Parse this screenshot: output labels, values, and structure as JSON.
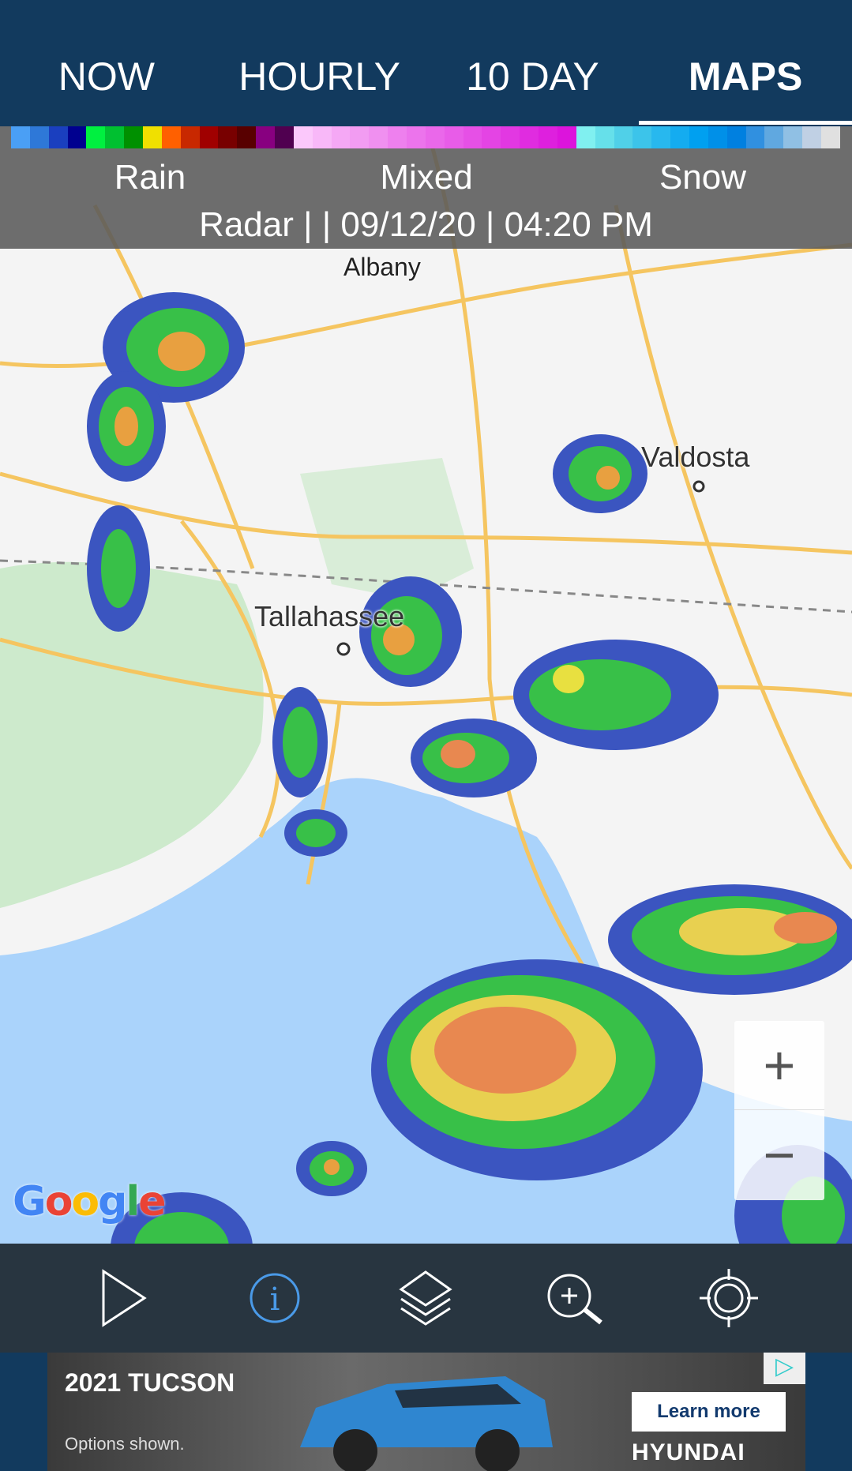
{
  "tabs": [
    {
      "label": "NOW"
    },
    {
      "label": "HOURLY"
    },
    {
      "label": "10 DAY"
    },
    {
      "label": "MAPS",
      "active": true
    }
  ],
  "legend": {
    "labels": {
      "rain": "Rain",
      "mixed": "Mixed",
      "snow": "Snow"
    },
    "rain_colors": [
      "#4a9ff5",
      "#2e78d8",
      "#1a3fbf",
      "#00008f",
      "#00f040",
      "#00c030",
      "#009000",
      "#f0e000",
      "#ff6000",
      "#c82800",
      "#a00000",
      "#780000",
      "#580000",
      "#880080",
      "#500050"
    ],
    "mixed_colors": [
      "#fbc8fb",
      "#f8b8f8",
      "#f5a8f5",
      "#f29cf2",
      "#f090f0",
      "#ee80ee",
      "#ec74ec",
      "#ea68ea",
      "#e85ce8",
      "#e650e6",
      "#e444e4",
      "#e238e2",
      "#e02ce0",
      "#de20de",
      "#dc14dc"
    ],
    "snow_colors": [
      "#80f0f0",
      "#66e0ea",
      "#50d0e8",
      "#3cc4ea",
      "#28b8ee",
      "#14acf0",
      "#00a0f0",
      "#0090e8",
      "#0080e0",
      "#3090e0",
      "#60a8e0",
      "#90c0e4",
      "#c0d0e4",
      "#e0e0e0"
    ]
  },
  "radar_status": "Radar |  | 09/12/20 | 04:20 PM",
  "map": {
    "cities": [
      {
        "name": "Tallahassee"
      },
      {
        "name": "Valdosta"
      },
      {
        "name": "Albany"
      }
    ],
    "attribution": "Google",
    "zoom_in": "+",
    "zoom_out": "−",
    "colors": {
      "land": "#f4f4f4",
      "water": "#aad3fb",
      "park": "#cdeacc",
      "road": "#f5c560"
    }
  },
  "toolbar": [
    {
      "icon": "play-icon"
    },
    {
      "icon": "info-icon",
      "active": true
    },
    {
      "icon": "layers-icon"
    },
    {
      "icon": "zoom-in-icon"
    },
    {
      "icon": "locate-icon"
    }
  ],
  "ad": {
    "headline": "2021 TUCSON",
    "disclaimer": "Options shown.",
    "cta": "Learn more",
    "brand": "HYUNDAI"
  }
}
